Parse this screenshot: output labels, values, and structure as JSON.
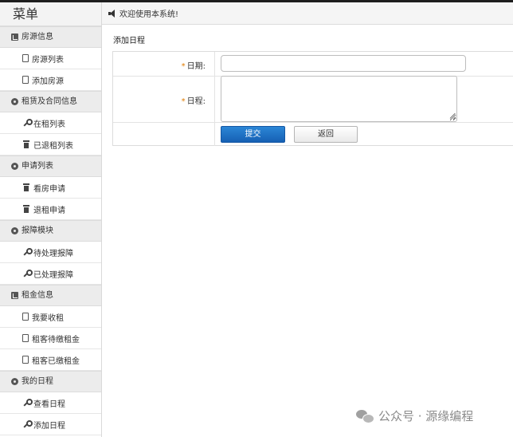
{
  "sidebar": {
    "title": "菜单",
    "groups": [
      {
        "label": "房源信息",
        "icon": "list-box-icon",
        "items": [
          {
            "label": "房源列表",
            "icon": "file-icon"
          },
          {
            "label": "添加房源",
            "icon": "file-icon"
          }
        ]
      },
      {
        "label": "租赁及合同信息",
        "icon": "gear-icon",
        "items": [
          {
            "label": "在租列表",
            "icon": "wrench-icon"
          },
          {
            "label": "已退租列表",
            "icon": "trash-icon"
          }
        ]
      },
      {
        "label": "申请列表",
        "icon": "gear-icon",
        "items": [
          {
            "label": "看房申请",
            "icon": "trash-icon"
          },
          {
            "label": "退租申请",
            "icon": "trash-icon"
          }
        ]
      },
      {
        "label": "报障模块",
        "icon": "gear-icon",
        "items": [
          {
            "label": "待处理报障",
            "icon": "wrench-icon"
          },
          {
            "label": "已处理报障",
            "icon": "wrench-icon"
          }
        ]
      },
      {
        "label": "租金信息",
        "icon": "list-box-icon",
        "items": [
          {
            "label": "我要收租",
            "icon": "file-icon"
          },
          {
            "label": "租客待缴租金",
            "icon": "file-icon"
          },
          {
            "label": "租客已缴租金",
            "icon": "file-icon"
          }
        ]
      },
      {
        "label": "我的日程",
        "icon": "gear-icon",
        "items": [
          {
            "label": "查看日程",
            "icon": "wrench-icon"
          },
          {
            "label": "添加日程",
            "icon": "wrench-icon"
          }
        ]
      }
    ]
  },
  "header": {
    "welcome": "欢迎使用本系统!",
    "icon": "speaker-icon"
  },
  "main": {
    "title": "添加日程",
    "form": {
      "required_mark": "*",
      "date_label": "日期:",
      "date_value": "",
      "schedule_label": "日程:",
      "schedule_value": "",
      "submit_label": "提交",
      "back_label": "返回"
    }
  },
  "watermark": {
    "text": "公众号 · 源缘编程",
    "icon": "wechat-icon"
  },
  "colors": {
    "primary_button": "#1e6fc4",
    "required": "#e07b00",
    "sidebar_header_bg": "#ececec"
  }
}
